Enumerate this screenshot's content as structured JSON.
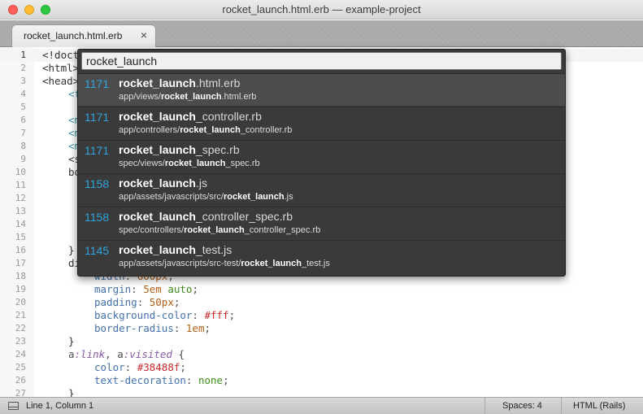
{
  "window": {
    "title": "rocket_launch.html.erb — example-project"
  },
  "tabs": [
    {
      "label": "rocket_launch.html.erb",
      "close": "×"
    }
  ],
  "editor": {
    "line_numbers": [
      "1",
      "2",
      "3",
      "4",
      "5",
      "6",
      "7",
      "8",
      "9",
      "10",
      "11",
      "12",
      "13",
      "14",
      "15",
      "16",
      "17",
      "18",
      "19",
      "20",
      "21",
      "22",
      "23",
      "24",
      "25",
      "26",
      "27"
    ],
    "current_line": 1,
    "visible_code": {
      "l1": "<!doct",
      "l2": "<html>",
      "l3": "<head>",
      "l4": "<t",
      "l6": "<m",
      "l7": "<m",
      "l8": "<m",
      "l9": "<s",
      "l10": "bo",
      "l16": "}",
      "l17": "di",
      "l18_prop": "width",
      "l18_val": "600px",
      "l19_prop": "margin",
      "l19_num": "5em",
      "l19_kw": "auto",
      "l20_prop": "padding",
      "l20_val": "50px",
      "l21_prop": "background-color",
      "l21_val": "#fff",
      "l22_prop": "border-radius",
      "l22_val": "1em",
      "l23": "}",
      "l24_sel": "a",
      "l24_pseudo1": ":link",
      "l24_sep": ", a",
      "l24_pseudo2": ":visited",
      "l24_brace": " {",
      "l25_prop": "color",
      "l25_val": "#38488f",
      "l26_prop": "text-decoration",
      "l26_val": "none",
      "l27": "}"
    }
  },
  "goto_anything": {
    "query": "rocket_launch",
    "results": [
      {
        "count": "1171",
        "name_match": "rocket_launch",
        "name_rest": ".html.erb",
        "path_pre": "app/views/",
        "path_match": "rocket_launch",
        "path_post": ".html.erb",
        "selected": true
      },
      {
        "count": "1171",
        "name_match": "rocket_launch",
        "name_rest": "_controller.rb",
        "path_pre": "app/controllers/",
        "path_match": "rocket_launch",
        "path_post": "_controller.rb",
        "selected": false
      },
      {
        "count": "1171",
        "name_match": "rocket_launch",
        "name_rest": "_spec.rb",
        "path_pre": "spec/views/",
        "path_match": "rocket_launch",
        "path_post": "_spec.rb",
        "selected": false
      },
      {
        "count": "1158",
        "name_match": "rocket_launch",
        "name_rest": ".js",
        "path_pre": "app/assets/javascripts/src/",
        "path_match": "rocket_launch",
        "path_post": ".js",
        "selected": false
      },
      {
        "count": "1158",
        "name_match": "rocket_launch",
        "name_rest": "_controller_spec.rb",
        "path_pre": "spec/controllers/",
        "path_match": "rocket_launch",
        "path_post": "_controller_spec.rb",
        "selected": false
      },
      {
        "count": "1145",
        "name_match": "rocket_launch",
        "name_rest": "_test.js",
        "path_pre": "app/assets/javascripts/src-test/",
        "path_match": "rocket_launch",
        "path_post": "_test.js",
        "selected": false
      }
    ]
  },
  "statusbar": {
    "icon": "panel-toggle-icon",
    "position": "Line 1, Column 1",
    "spaces": "Spaces: 4",
    "syntax": "HTML (Rails)"
  }
}
